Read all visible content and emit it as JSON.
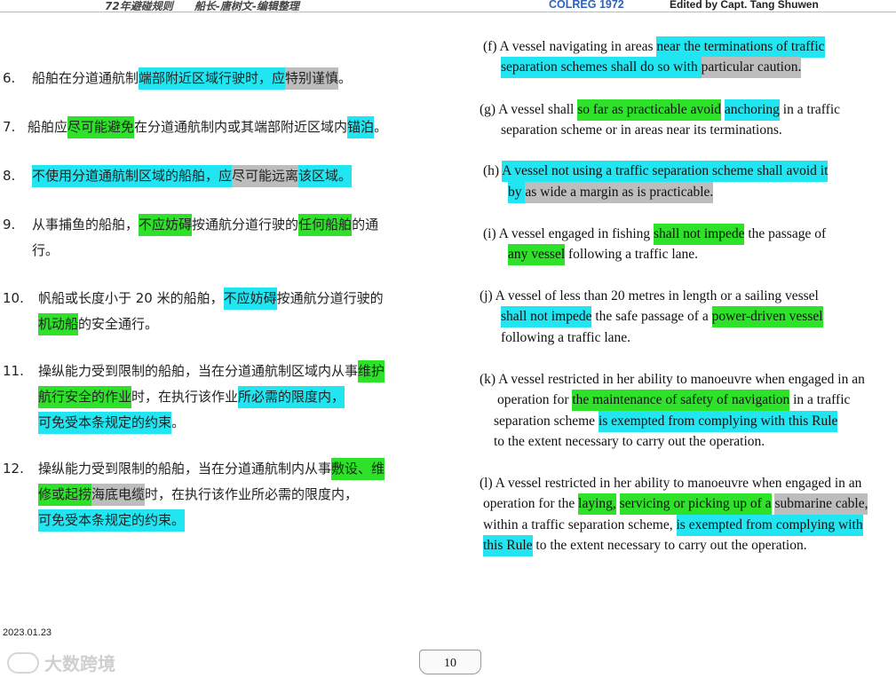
{
  "header": {
    "title_cn": "72年避碰规则",
    "author_cn": "船长-唐树文-编辑整理",
    "colreg": "COLREG 1972",
    "edited_by": "Edited by Capt. Tang Shuwen"
  },
  "cn": {
    "i6": {
      "num": "6.",
      "a": "船舶在分道通航制",
      "b": "端部附近区域行驶时，应",
      "c": "特别谨慎",
      "d": "。"
    },
    "i7": {
      "num": "7.",
      "a": "船舶应",
      "b": "尽可能避免",
      "c": "在分道通航制内或其端部附近区域内",
      "d": "锚泊",
      "e": "。"
    },
    "i8": {
      "num": "8.",
      "a": "不使用分道通航制区域的船舶，应",
      "b": "尽可能远离",
      "c": "该区域。"
    },
    "i9": {
      "num": "9.",
      "a": "从事捕鱼的船舶，",
      "b": "不应妨碍",
      "c": "按通航分道行驶的",
      "d": "任何船舶",
      "e": "的通",
      "f": "行。"
    },
    "i10": {
      "num": "10.",
      "a": "帆船或长度小于 20 米的船舶，",
      "b": "不应妨碍",
      "c": "按通航分道行驶的",
      "d": "机动船",
      "e": "的安全通行。"
    },
    "i11": {
      "num": "11.",
      "a": "操纵能力受到限制的船舶，当在分道通航制区域内从事",
      "b": "维护",
      "c": "航行安全的作业",
      "d": "时，在执行该作业",
      "e": "所必需的限度内，",
      "f": "可免受本条规定的约束",
      "g": "。"
    },
    "i12": {
      "num": "12.",
      "a": "操纵能力受到限制的船舶，当在分道通航制内从事",
      "b": "敷设、维",
      "c": "修或起捞",
      "d": "海底电缆",
      "e": "时，在执行该作业所必需的限度内，",
      "f": "可免受本条规定的约束。"
    }
  },
  "en": {
    "f": {
      "a": "(f) A vessel navigating in areas ",
      "b": "near the terminations of traffic",
      "c": "separation schemes shall do so with ",
      "d": "particular caution."
    },
    "g": {
      "a": "(g) A vessel shall ",
      "b": "so far as practicable avoid",
      "c": " ",
      "d": "anchoring",
      "e": " in a traffic",
      "f": "separation scheme or in areas near its terminations."
    },
    "h": {
      "a": "(h) ",
      "b": "A vessel not using a traffic separation scheme shall avoid it",
      "c": "by ",
      "d": "as wide a margin as is practicable."
    },
    "i": {
      "a": "(i) A vessel engaged in fishing ",
      "b": "shall not impede",
      "c": " the passage of",
      "d": "any vessel",
      "e": " following a traffic lane."
    },
    "j": {
      "a": "(j) A vessel of less than 20 metres in length or a sailing vessel",
      "b": "shall not impede",
      "c": " the safe passage of a ",
      "d": "power-driven vessel",
      "e": "following a traffic lane."
    },
    "k": {
      "a": "(k) A vessel restricted in her ability to manoeuvre when engaged in an",
      "b": "operation for ",
      "c": "the maintenance of safety of navigation",
      "d": " in a traffic",
      "e": "separation scheme ",
      "f": "is exempted from complying with this Rule",
      "g": "to the extent  necessary to carry out the operation."
    },
    "l": {
      "a": "(l) A vessel restricted in her ability to manoeuvre when engaged in an",
      "b": "operation for the ",
      "c": "laying,",
      "d": " ",
      "e": "servicing or picking up of a",
      "f": " ",
      "g": "submarine cable,",
      "h": "within a traffic separation scheme, ",
      "i": "is exempted from complying with",
      "j": "this Rule",
      "k": " to the extent necessary to carry out the operation."
    }
  },
  "footer": {
    "date": "2023.01.23",
    "watermark": "大数跨境",
    "page": "10"
  }
}
